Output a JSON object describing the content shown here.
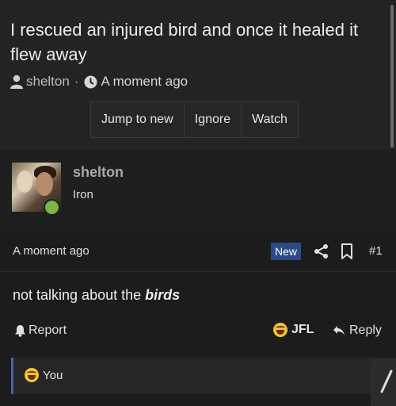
{
  "thread": {
    "title": "I rescued an injured bird and once it healed it flew away",
    "author": "shelton",
    "separator": "·",
    "time": "A moment ago",
    "buttons": [
      "Jump to new",
      "Ignore",
      "Watch"
    ]
  },
  "user": {
    "name": "shelton",
    "title": "Iron",
    "status_color": "#7ab547"
  },
  "post": {
    "time": "A moment ago",
    "badge": "New",
    "number": "#1",
    "text_prefix": "not talking about the ",
    "text_emphasis": "birds",
    "actions": {
      "report": "Report",
      "reaction_label": "JFL",
      "reply": "Reply"
    },
    "reactions_bar": {
      "text": "You"
    }
  },
  "colors": {
    "accent": "#2c4a8a",
    "quote_border": "#4a63a8",
    "online": "#7ab547"
  }
}
